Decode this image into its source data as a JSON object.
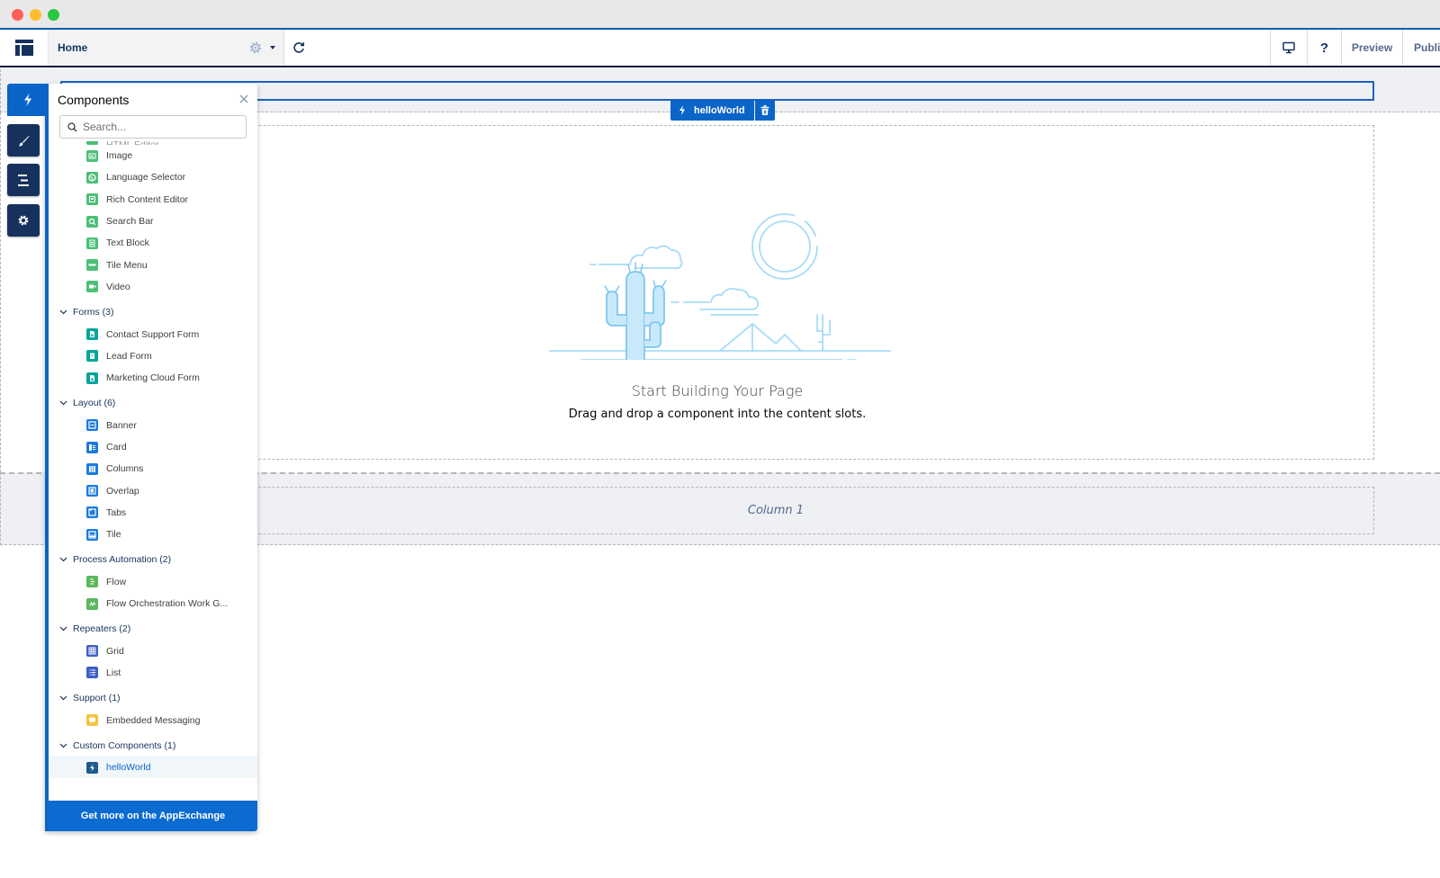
{
  "window": {
    "traffic_lights": [
      "close",
      "minimize",
      "maximize"
    ]
  },
  "header": {
    "page_name": "Home",
    "help_label": "?",
    "preview_label": "Preview",
    "publish_label": "Publish"
  },
  "canvas": {
    "selected_component": "helloWorld",
    "empty_state": {
      "title": "Start Building Your Page",
      "subtitle": "Drag and drop a component into the content slots."
    },
    "column_label": "Column 1"
  },
  "panel": {
    "title": "Components",
    "search_placeholder": "Search...",
    "partial_item": "HTML Editor",
    "top_items": [
      {
        "label": "Image",
        "icon": "image-icon",
        "color": "#4bc076"
      },
      {
        "label": "Language Selector",
        "icon": "globe-icon",
        "color": "#4bc076"
      },
      {
        "label": "Rich Content Editor",
        "icon": "editor-icon",
        "color": "#4bc076"
      },
      {
        "label": "Search Bar",
        "icon": "search-icon",
        "color": "#4bc076"
      },
      {
        "label": "Text Block",
        "icon": "text-icon",
        "color": "#4bc076"
      },
      {
        "label": "Tile Menu",
        "icon": "tile-menu-icon",
        "color": "#4bc076"
      },
      {
        "label": "Video",
        "icon": "video-icon",
        "color": "#4bc076"
      }
    ],
    "categories": [
      {
        "label": "Forms (3)",
        "items": [
          {
            "label": "Contact Support Form",
            "icon": "form-icon",
            "color": "#06a59a"
          },
          {
            "label": "Lead Form",
            "icon": "clipboard-icon",
            "color": "#06a59a"
          },
          {
            "label": "Marketing Cloud Form",
            "icon": "form-icon",
            "color": "#06a59a"
          }
        ]
      },
      {
        "label": "Layout (6)",
        "items": [
          {
            "label": "Banner",
            "icon": "banner-icon",
            "color": "#1b7ae0"
          },
          {
            "label": "Card",
            "icon": "card-icon",
            "color": "#1b7ae0"
          },
          {
            "label": "Columns",
            "icon": "columns-icon",
            "color": "#1b7ae0"
          },
          {
            "label": "Overlap",
            "icon": "overlap-icon",
            "color": "#1b7ae0"
          },
          {
            "label": "Tabs",
            "icon": "tabs-icon",
            "color": "#1b7ae0"
          },
          {
            "label": "Tile",
            "icon": "tile-icon",
            "color": "#1b7ae0"
          }
        ]
      },
      {
        "label": "Process Automation (2)",
        "items": [
          {
            "label": "Flow",
            "icon": "flow-icon",
            "color": "#5cb85c"
          },
          {
            "label": "Flow Orchestration Work G...",
            "icon": "orchestration-icon",
            "color": "#5cb85c"
          }
        ]
      },
      {
        "label": "Repeaters (2)",
        "items": [
          {
            "label": "Grid",
            "icon": "grid-icon",
            "color": "#3c5fc7"
          },
          {
            "label": "List",
            "icon": "list-icon",
            "color": "#3c5fc7"
          }
        ]
      },
      {
        "label": "Support (1)",
        "items": [
          {
            "label": "Embedded Messaging",
            "icon": "chat-icon",
            "color": "#f4c542"
          }
        ]
      },
      {
        "label": "Custom Components (1)",
        "items": [
          {
            "label": "helloWorld",
            "icon": "lightning-icon",
            "color": "#1e5a8e",
            "selected": true
          }
        ]
      }
    ],
    "footer_label": "Get more on the AppExchange"
  },
  "rail": {
    "tabs": [
      {
        "name": "components",
        "icon": "lightning-icon",
        "active": true
      },
      {
        "name": "theme",
        "icon": "brush-icon",
        "active": false
      },
      {
        "name": "navigation",
        "icon": "structure-icon",
        "active": false
      },
      {
        "name": "settings",
        "icon": "gear-icon",
        "active": false
      }
    ]
  }
}
